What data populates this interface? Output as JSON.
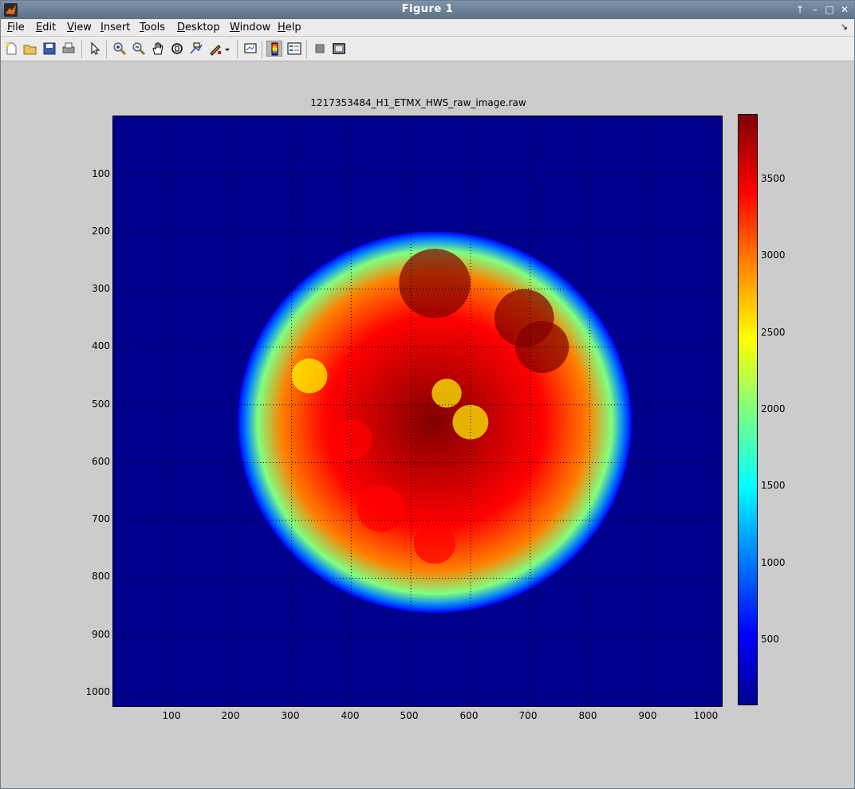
{
  "window": {
    "title": "Figure 1",
    "controls": [
      "↑",
      "–",
      "□",
      "✕"
    ]
  },
  "menu": {
    "items": [
      {
        "first": "F",
        "rest": "ile"
      },
      {
        "first": "E",
        "rest": "dit"
      },
      {
        "first": "V",
        "rest": "iew"
      },
      {
        "first": "I",
        "rest": "nsert"
      },
      {
        "first": "T",
        "rest": "ools"
      },
      {
        "first": "D",
        "rest": "esktop"
      },
      {
        "first": "W",
        "rest": "indow"
      },
      {
        "first": "H",
        "rest": "elp"
      }
    ],
    "corner": "↘"
  },
  "toolbar": {
    "icons": [
      "new-figure-icon",
      "open-file-icon",
      "save-icon",
      "print-icon",
      "select-arrow-icon",
      "zoom-in-icon",
      "zoom-out-icon",
      "pan-hand-icon",
      "rotate-3d-icon",
      "data-cursor-icon",
      "brush-icon",
      "link-plot-icon",
      "colorbar-icon",
      "legend-icon",
      "hide-plot-tools-icon",
      "show-plot-tools-icon"
    ]
  },
  "figure": {
    "title": "1217353484_H1_ETMX_HWS_raw_image.raw",
    "y_ticks": [
      "100",
      "200",
      "300",
      "400",
      "500",
      "600",
      "700",
      "800",
      "900",
      "1000"
    ],
    "x_ticks": [
      "100",
      "200",
      "300",
      "400",
      "500",
      "600",
      "700",
      "800",
      "900",
      "1000"
    ],
    "colorbar_ticks": [
      "3500",
      "3000",
      "2500",
      "2000",
      "1500",
      "1000",
      "500"
    ],
    "colormap": [
      "#00008f",
      "#0000ff",
      "#0080ff",
      "#00ffff",
      "#80ff80",
      "#ffff00",
      "#ff8000",
      "#ff0000",
      "#800000"
    ]
  },
  "chart_data": {
    "type": "heatmap",
    "title": "1217353484_H1_ETMX_HWS_raw_image.raw",
    "xlabel": "",
    "ylabel": "",
    "xlim": [
      1,
      1024
    ],
    "ylim": [
      1024,
      1
    ],
    "color_range": [
      100,
      3900
    ],
    "grid": true,
    "colorbar_ticks": [
      500,
      1000,
      1500,
      2000,
      2500,
      3000,
      3500
    ],
    "feature": {
      "description_free": true,
      "center_x": 540,
      "center_y": 530,
      "radius": 330,
      "peak_value": 3800,
      "edge_value": 1600,
      "background_value": 250
    }
  }
}
